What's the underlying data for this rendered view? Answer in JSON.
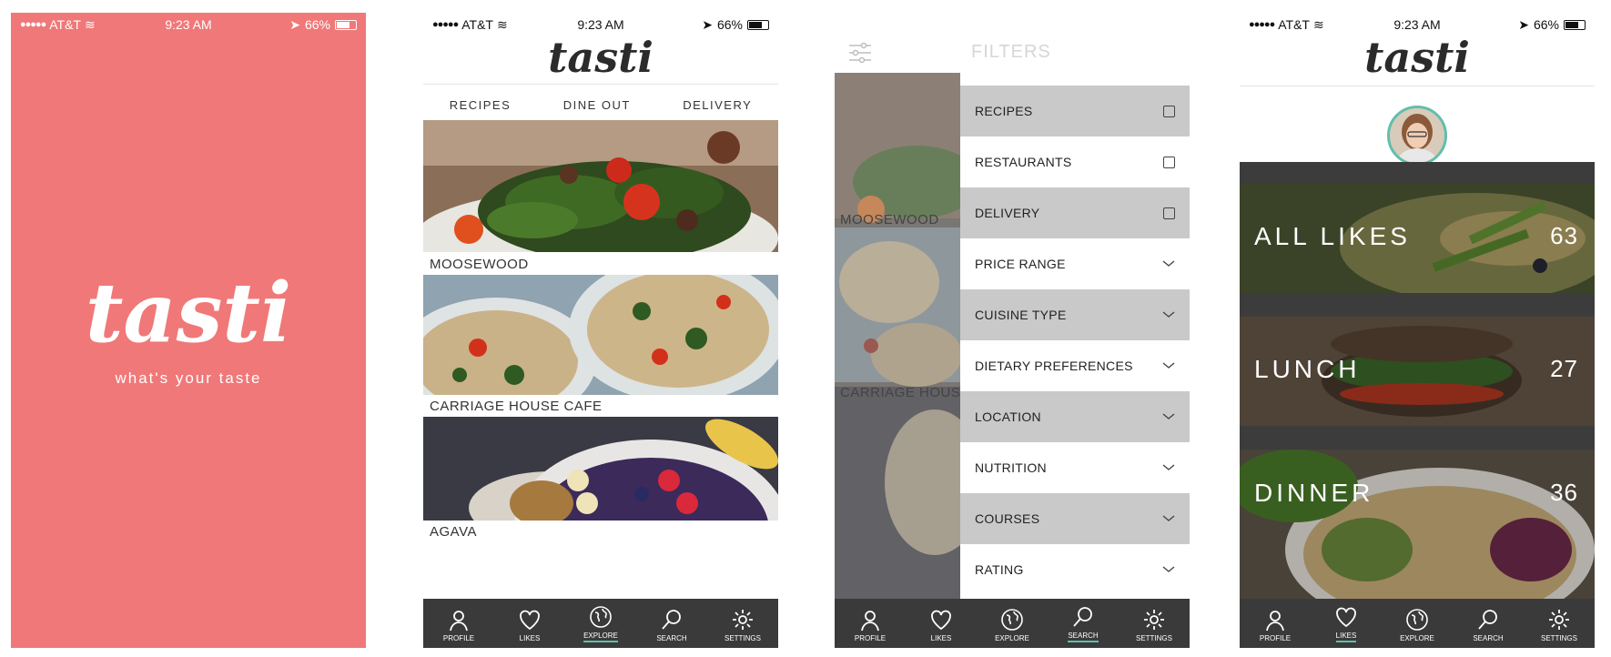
{
  "status": {
    "carrier": "AT&T",
    "time": "9:23 AM",
    "battery": "66%"
  },
  "app": {
    "logo": "tasti",
    "tagline": "what's your taste"
  },
  "top_tabs": [
    "RECIPES",
    "DINE OUT",
    "DELIVERY"
  ],
  "feed": [
    {
      "name": "MOOSEWOOD"
    },
    {
      "name": "CARRIAGE HOUSE CAFE"
    },
    {
      "name": "AGAVA"
    }
  ],
  "filters": {
    "title": "FILTERS",
    "bg_labels": [
      "MOOSEWOOD",
      "CARRIAGE HOUSE"
    ],
    "items": [
      {
        "label": "RECIPES",
        "control": "checkbox"
      },
      {
        "label": "RESTAURANTS",
        "control": "checkbox"
      },
      {
        "label": "DELIVERY",
        "control": "checkbox"
      },
      {
        "label": "PRICE RANGE",
        "control": "chevron"
      },
      {
        "label": "CUISINE TYPE",
        "control": "chevron"
      },
      {
        "label": "DIETARY PREFERENCES",
        "control": "chevron"
      },
      {
        "label": "LOCATION",
        "control": "chevron"
      },
      {
        "label": "NUTRITION",
        "control": "chevron"
      },
      {
        "label": "COURSES",
        "control": "chevron"
      },
      {
        "label": "RATING",
        "control": "chevron"
      }
    ]
  },
  "likes": [
    {
      "label": "ALL LIKES",
      "count": "63"
    },
    {
      "label": "LUNCH",
      "count": "27"
    },
    {
      "label": "DINNER",
      "count": "36"
    }
  ],
  "tabbar": {
    "items": [
      {
        "label": "PROFILE",
        "icon": "profile-icon"
      },
      {
        "label": "LIKES",
        "icon": "heart-icon"
      },
      {
        "label": "EXPLORE",
        "icon": "globe-icon"
      },
      {
        "label": "SEARCH",
        "icon": "search-icon"
      },
      {
        "label": "SETTINGS",
        "icon": "gear-icon"
      }
    ]
  },
  "colors": {
    "splash": "#f07878",
    "accent": "#5fbfae",
    "tabbar": "#3a3a3a",
    "filter_gray": "#c9c9c9"
  }
}
